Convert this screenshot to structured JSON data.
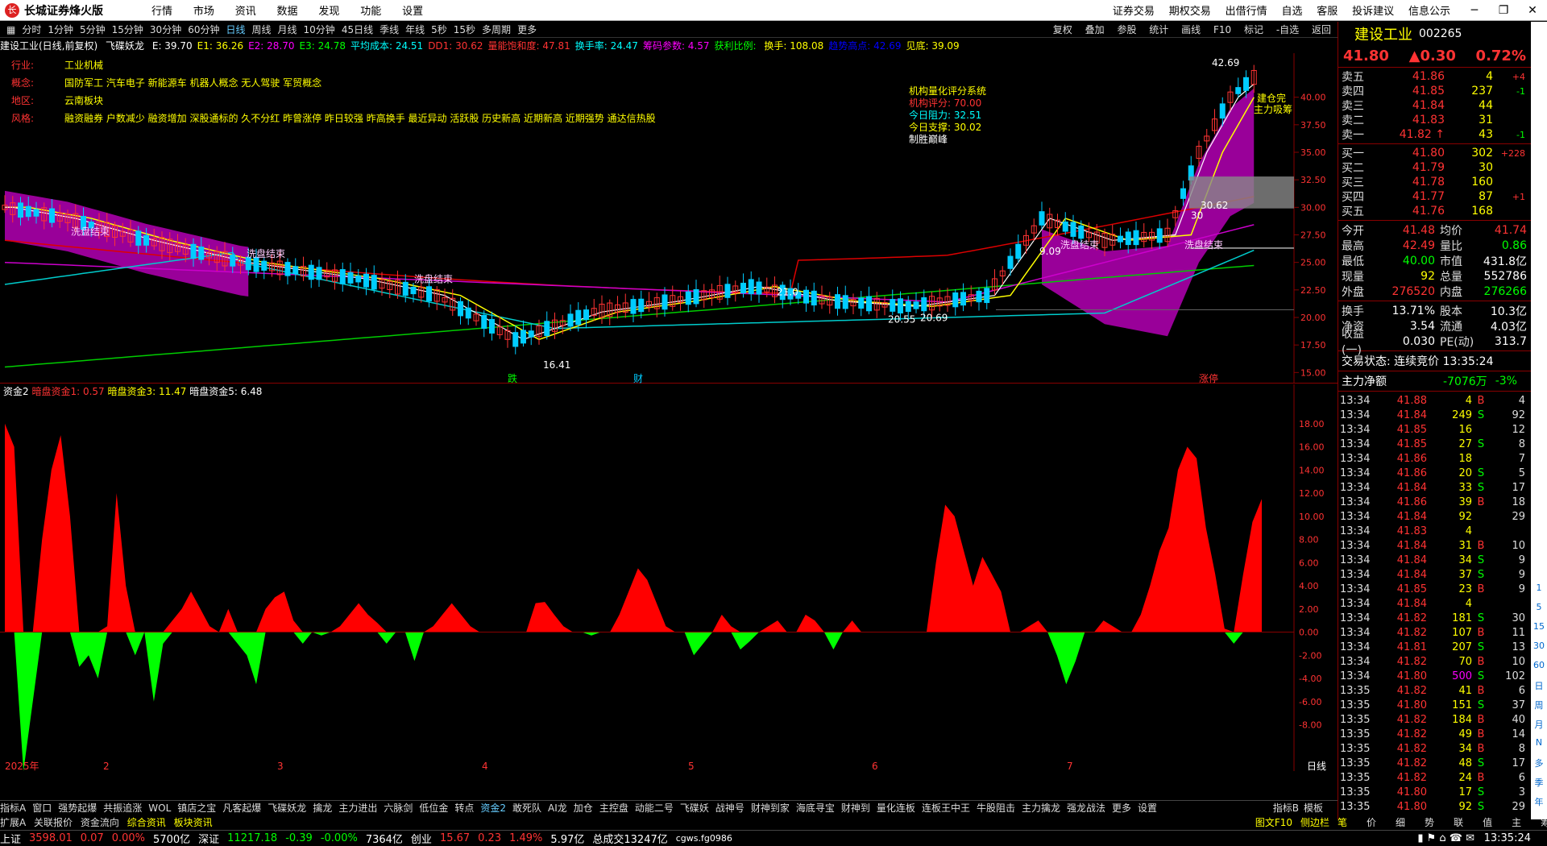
{
  "titlebar": {
    "app": "长城证券烽火版",
    "menu": [
      "行情",
      "市场",
      "资讯",
      "数据",
      "发现",
      "功能",
      "设置"
    ],
    "right_menu": [
      "证券交易",
      "期权交易",
      "出借行情",
      "自选",
      "客服",
      "投诉建议",
      "信息公示"
    ]
  },
  "periods": [
    "分时",
    "1分钟",
    "5分钟",
    "15分钟",
    "30分钟",
    "60分钟",
    "日线",
    "周线",
    "月线",
    "10分钟",
    "45日线",
    "季线",
    "年线",
    "5秒",
    "15秒",
    "多周期",
    "更多"
  ],
  "active_period": "日线",
  "toolbar_right": [
    "复权",
    "叠加",
    "参股",
    "统计",
    "画线",
    "F10",
    "标记",
    "-自选",
    "返回"
  ],
  "infobar": {
    "stock": "建设工业(日线,前复权)",
    "indicator": "飞碟妖龙",
    "items": [
      {
        "text": "E: 39.70",
        "color": "#fff"
      },
      {
        "text": "E1: 36.26",
        "color": "#ff0"
      },
      {
        "text": "E2: 28.70",
        "color": "#f0f"
      },
      {
        "text": "E3: 24.78",
        "color": "#0f0"
      },
      {
        "text": "平均成本: 24.51",
        "color": "#0ff"
      },
      {
        "text": "DD1: 30.62",
        "color": "#f33"
      },
      {
        "text": "量能饱和度: 47.81",
        "color": "#f33"
      },
      {
        "text": "换手率: 24.47",
        "color": "#0ff"
      },
      {
        "text": "筹码参数: 4.57",
        "color": "#f0f"
      },
      {
        "text": "获利比例: ",
        "color": "#0f0"
      },
      {
        "text": "换手: 108.08",
        "color": "#ff0"
      },
      {
        "text": "趋势高点: 42.69",
        "color": "#00f"
      },
      {
        "text": "见底: 39.09",
        "color": "#ff0"
      }
    ]
  },
  "concepts": [
    {
      "label": "行业:",
      "value": "工业机械"
    },
    {
      "label": "概念:",
      "value": "国防军工 汽车电子 新能源车 机器人概念 无人驾驶 军贸概念"
    },
    {
      "label": "地区:",
      "value": "云南板块"
    },
    {
      "label": "风格:",
      "value": "融资融券 户数减少 融资增加 深股通标的 久不分红 昨曾涨停 昨日较强 昨高换手 最近异动 活跃股 历史新高 近期新高 近期强势 通达信热股"
    }
  ],
  "score_box": {
    "title": "机构量化评分系统",
    "rating": "机构评分: 70.00",
    "resist": "今日阻力: 32.51",
    "support": "今日支撑: 30.02",
    "footer": "制胜巅峰"
  },
  "price_axis": [
    "40.00",
    "37.50",
    "35.00",
    "32.50",
    "30.00",
    "27.50",
    "25.00",
    "22.50",
    "20.00",
    "17.50",
    "15.00"
  ],
  "price_annotations": {
    "high": "42.69",
    "low": "16.41",
    "p1": "20.55",
    "p2": "20.69",
    "p3": "30.62",
    "p4": "30",
    "p5": "9.09",
    "p6": "21.0"
  },
  "chart_labels": {
    "wash1": "洗盘结束",
    "wash2": "洗盘结束",
    "wash3": "洗盘结束",
    "wash4": "洗盘结束",
    "wash5": "洗盘结束",
    "build": "建仓完",
    "main": "主力吸筹",
    "m1": "跌",
    "m2": "财",
    "m3": "涨停"
  },
  "sub_chart": {
    "name": "资金2",
    "items": [
      {
        "text": "暗盘资金1: 0.57",
        "color": "#f33"
      },
      {
        "text": "暗盘资金3: 11.47",
        "color": "#ff0"
      },
      {
        "text": "暗盘资金5: 6.48",
        "color": "#fff"
      }
    ],
    "axis": [
      "18.00",
      "16.00",
      "14.00",
      "12.00",
      "10.00",
      "8.00",
      "6.00",
      "4.00",
      "2.00",
      "0.00",
      "-2.00",
      "-4.00",
      "-6.00",
      "-8.00"
    ]
  },
  "x_axis": [
    "2025年",
    "2",
    "3",
    "4",
    "5",
    "6",
    "7"
  ],
  "x_axis_right": "日线",
  "chart_data": {
    "type": "bar",
    "title": "",
    "ylim": [
      -12,
      20
    ],
    "values": [
      18,
      16,
      -12,
      -6,
      8,
      14,
      17,
      10,
      -3,
      -2,
      -4,
      0.5,
      12,
      4,
      -2,
      0,
      -6,
      -1,
      1,
      2,
      3.5,
      2,
      0.5,
      0,
      2,
      -1,
      -2,
      -4.5,
      2,
      3,
      3.5,
      1,
      -1,
      0,
      -0.3,
      0,
      0.5,
      1.5,
      2.5,
      1.5,
      0.8,
      -1,
      0,
      0,
      -2.5,
      0,
      0.5,
      1.5,
      2.5,
      1.5,
      0.5,
      0,
      0,
      0,
      0,
      0,
      0,
      2.5,
      2.6,
      1.5,
      0.5,
      0,
      0,
      -0.3,
      0,
      0,
      1.5,
      3.5,
      5.5,
      4.5,
      2.5,
      0.5,
      0,
      0,
      -2,
      -1,
      0,
      1.5,
      0.5,
      -1.5,
      -0.8,
      0,
      0.5,
      1,
      0,
      0,
      1.5,
      1,
      0,
      -1.5,
      0,
      1,
      0,
      0,
      0,
      0,
      0,
      0,
      0,
      0,
      6,
      11,
      10,
      7,
      4,
      6.5,
      5,
      3.5,
      0,
      0,
      0.5,
      1,
      0,
      -2,
      -4.5,
      -2.5,
      0,
      0,
      1,
      0.5,
      0,
      0,
      1.5,
      4,
      7,
      9,
      14,
      16,
      15,
      9,
      5,
      0.3,
      -1,
      5,
      9.5,
      11.5
    ]
  },
  "right_panel": {
    "name": "建设工业",
    "code": "002265",
    "price": "41.80",
    "change": "▲0.30",
    "pct": "0.72%",
    "sell": [
      {
        "label": "卖五",
        "price": "41.86",
        "vol": "4",
        "chg": "+4"
      },
      {
        "label": "卖四",
        "price": "41.85",
        "vol": "237",
        "chg": "-1"
      },
      {
        "label": "卖三",
        "price": "41.84",
        "vol": "44",
        "chg": ""
      },
      {
        "label": "卖二",
        "price": "41.83",
        "vol": "31",
        "chg": ""
      },
      {
        "label": "卖一",
        "price": "41.82 ↑",
        "vol": "43",
        "chg": "-1"
      }
    ],
    "buy": [
      {
        "label": "买一",
        "price": "41.80",
        "vol": "302",
        "chg": "+228"
      },
      {
        "label": "买二",
        "price": "41.79",
        "vol": "30",
        "chg": ""
      },
      {
        "label": "买三",
        "price": "41.78",
        "vol": "160",
        "chg": ""
      },
      {
        "label": "买四",
        "price": "41.77",
        "vol": "87",
        "chg": "+1"
      },
      {
        "label": "买五",
        "price": "41.76",
        "vol": "168",
        "chg": ""
      }
    ],
    "stats": [
      {
        "k": "今开",
        "v": "41.48",
        "vc": "#f33",
        "k2": "均价",
        "v2": "41.74",
        "v2c": "#f33"
      },
      {
        "k": "最高",
        "v": "42.49",
        "vc": "#f33",
        "k2": "量比",
        "v2": "0.86",
        "v2c": "#0f0"
      },
      {
        "k": "最低",
        "v": "40.00",
        "vc": "#0f0",
        "k2": "市值",
        "v2": "431.8亿",
        "v2c": "#fff"
      },
      {
        "k": "现量",
        "v": "92",
        "vc": "#ff0",
        "k2": "总量",
        "v2": "552786",
        "v2c": "#fff"
      },
      {
        "k": "外盘",
        "v": "276520",
        "vc": "#f33",
        "k2": "内盘",
        "v2": "276266",
        "v2c": "#0f0"
      }
    ],
    "stats2": [
      {
        "k": "换手",
        "v": "13.71%",
        "vc": "#fff",
        "k2": "股本",
        "v2": "10.3亿",
        "v2c": "#fff"
      },
      {
        "k": "净资",
        "v": "3.54",
        "vc": "#fff",
        "k2": "流通",
        "v2": "4.03亿",
        "v2c": "#fff"
      },
      {
        "k": "收益(一)",
        "v": "0.030",
        "vc": "#fff",
        "k2": "PE(动)",
        "v2": "313.7",
        "v2c": "#fff"
      }
    ],
    "trade_status": "交易状态: 连续竞价 13:35:24",
    "main_net_label": "主力净额",
    "main_net": "-7076万",
    "main_net_pct": "-3%",
    "ticks": [
      [
        "13:34",
        "41.88",
        "4",
        "B",
        "4"
      ],
      [
        "13:34",
        "41.84",
        "249",
        "S",
        "92"
      ],
      [
        "13:34",
        "41.85",
        "16",
        "",
        "12"
      ],
      [
        "13:34",
        "41.85",
        "27",
        "S",
        "8"
      ],
      [
        "13:34",
        "41.86",
        "18",
        "",
        "7"
      ],
      [
        "13:34",
        "41.86",
        "20",
        "S",
        "5"
      ],
      [
        "13:34",
        "41.84",
        "33",
        "S",
        "17"
      ],
      [
        "13:34",
        "41.86",
        "39",
        "B",
        "18"
      ],
      [
        "13:34",
        "41.84",
        "92",
        "",
        "29"
      ],
      [
        "13:34",
        "41.83",
        "4",
        "",
        ""
      ],
      [
        "13:34",
        "41.84",
        "31",
        "B",
        "10"
      ],
      [
        "13:34",
        "41.84",
        "34",
        "S",
        "9"
      ],
      [
        "13:34",
        "41.84",
        "37",
        "S",
        "9"
      ],
      [
        "13:34",
        "41.85",
        "23",
        "B",
        "9"
      ],
      [
        "13:34",
        "41.84",
        "4",
        "",
        ""
      ],
      [
        "13:34",
        "41.82",
        "181",
        "S",
        "30"
      ],
      [
        "13:34",
        "41.82",
        "107",
        "B",
        "11"
      ],
      [
        "13:34",
        "41.81",
        "207",
        "S",
        "13"
      ],
      [
        "13:34",
        "41.82",
        "70",
        "B",
        "10"
      ],
      [
        "13:34",
        "41.80",
        "500",
        "S",
        "102"
      ],
      [
        "13:35",
        "41.82",
        "41",
        "B",
        "6"
      ],
      [
        "13:35",
        "41.80",
        "151",
        "S",
        "37"
      ],
      [
        "13:35",
        "41.82",
        "184",
        "B",
        "40"
      ],
      [
        "13:35",
        "41.82",
        "49",
        "B",
        "14"
      ],
      [
        "13:35",
        "41.82",
        "34",
        "B",
        "8"
      ],
      [
        "13:35",
        "41.82",
        "48",
        "S",
        "17"
      ],
      [
        "13:35",
        "41.82",
        "24",
        "B",
        "6"
      ],
      [
        "13:35",
        "41.80",
        "17",
        "S",
        "3"
      ],
      [
        "13:35",
        "41.80",
        "92",
        "S",
        "29"
      ]
    ],
    "bottom_tabs": [
      "笔",
      "价",
      "细",
      "势",
      "联",
      "值",
      "主",
      "筹"
    ]
  },
  "far_right_icons": [
    "年",
    "季",
    "多",
    "N",
    "月",
    "周",
    "日",
    "60",
    "30",
    "15",
    "5",
    "1"
  ],
  "bottom_tabs": [
    "指标A",
    "窗口",
    "强势起爆",
    "共振追涨",
    "WOL",
    "镇店之宝",
    "凡客起爆",
    "飞碟妖龙",
    "擒龙",
    "主力进出",
    "六脉剑",
    "低位金",
    "转点",
    "资金2",
    "敢死队",
    "AI龙",
    "加仓",
    "主控盘",
    "动能二号",
    "飞碟妖",
    "战神号",
    "财神到家",
    "海底寻宝",
    "财神到",
    "量化连板",
    "连板王中王",
    "牛股阻击",
    "主力擒龙",
    "强龙战法",
    "更多",
    "设置"
  ],
  "bottom_tabs_right": [
    "指标B",
    "模板"
  ],
  "active_tab": "资金2",
  "bottom_tabs2": [
    "扩展A",
    "关联报价",
    "资金流向",
    "综合资讯",
    "板块资讯"
  ],
  "bottom_tabs2_right": [
    "图文F10",
    "侧边栏"
  ],
  "status": {
    "sh_label": "上证",
    "sh": "3598.01",
    "sh_chg": "0.07",
    "sh_pct": "0.00%",
    "sh_amt": "5700亿",
    "sz_label": "深证",
    "sz": "11217.18",
    "sz_chg": "-0.39",
    "sz_pct": "-0.00%",
    "sz_amt": "7364亿",
    "cy_label": "创业",
    "cy": "15.67",
    "cy_chg": "0.23",
    "cy_pct": "1.49%",
    "cy_amt": "5.97亿",
    "total": "总成交13247亿",
    "server": "cgws.fg0986",
    "time": "13:35:24"
  }
}
